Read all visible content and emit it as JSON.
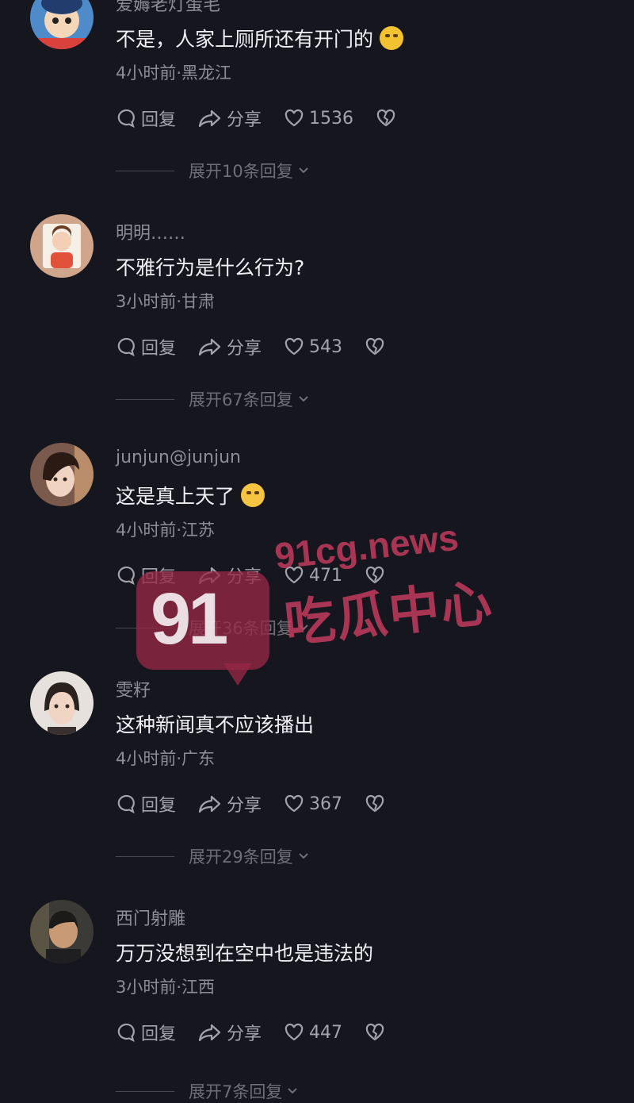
{
  "labels": {
    "reply": "回复",
    "share": "分享"
  },
  "comments": [
    {
      "username": "爱薅老灯蛋毛",
      "text": "不是，人家上厕所还有开门的",
      "emoji": "rofl",
      "time_location": "4小时前·黑龙江",
      "likes": "1536",
      "expand": "展开10条回复"
    },
    {
      "username": "明明……",
      "text": "不雅行为是什么行为?",
      "emoji": "",
      "time_location": "3小时前·甘肃",
      "likes": "543",
      "expand": "展开67条回复"
    },
    {
      "username": "junjun@junjun",
      "text": "这是真上天了",
      "emoji": "kiss",
      "time_location": "4小时前·江苏",
      "likes": "471",
      "expand": "展开36条回复"
    },
    {
      "username": "雯籽",
      "text": "这种新闻真不应该播出",
      "emoji": "",
      "time_location": "4小时前·广东",
      "likes": "367",
      "expand": "展开29条回复"
    },
    {
      "username": "西门射雕",
      "text": "万万没想到在空中也是违法的",
      "emoji": "",
      "time_location": "3小时前·江西",
      "likes": "447",
      "expand": "展开7条回复"
    }
  ],
  "watermark": {
    "number": "91",
    "site": "91cg.news",
    "name": "吃瓜中心",
    "color": "#c83c5f"
  }
}
